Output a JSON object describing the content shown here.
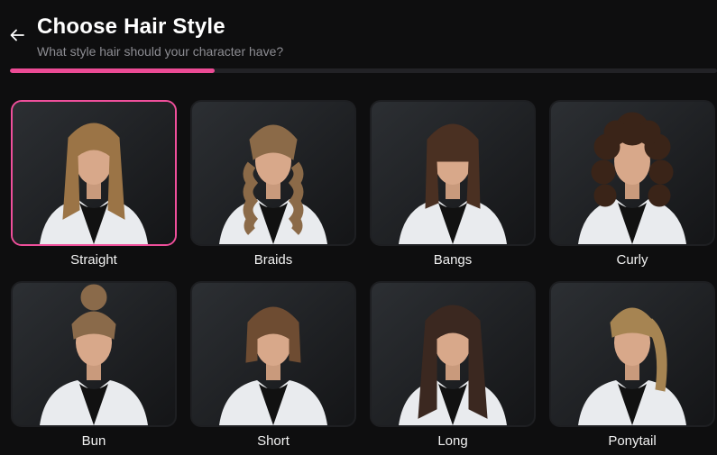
{
  "header": {
    "back_icon": "arrow-left-icon",
    "title": "Choose Hair Style",
    "subtitle": "What style hair should your character have?"
  },
  "progress": {
    "value": 0.29,
    "fill_color": "#ec4b95",
    "track_color": "#222226"
  },
  "styles": {
    "selected": "Straight",
    "highlight_color": "#ef4f9b",
    "items": [
      {
        "label": "Straight",
        "hair_color": "#9b7446"
      },
      {
        "label": "Braids",
        "hair_color": "#8b6a48"
      },
      {
        "label": "Bangs",
        "hair_color": "#4a3022"
      },
      {
        "label": "Curly",
        "hair_color": "#3a2418"
      },
      {
        "label": "Bun",
        "hair_color": "#8a6a4a"
      },
      {
        "label": "Short",
        "hair_color": "#6e4c32"
      },
      {
        "label": "Long",
        "hair_color": "#3b2820"
      },
      {
        "label": "Ponytail",
        "hair_color": "#a68452"
      }
    ]
  }
}
